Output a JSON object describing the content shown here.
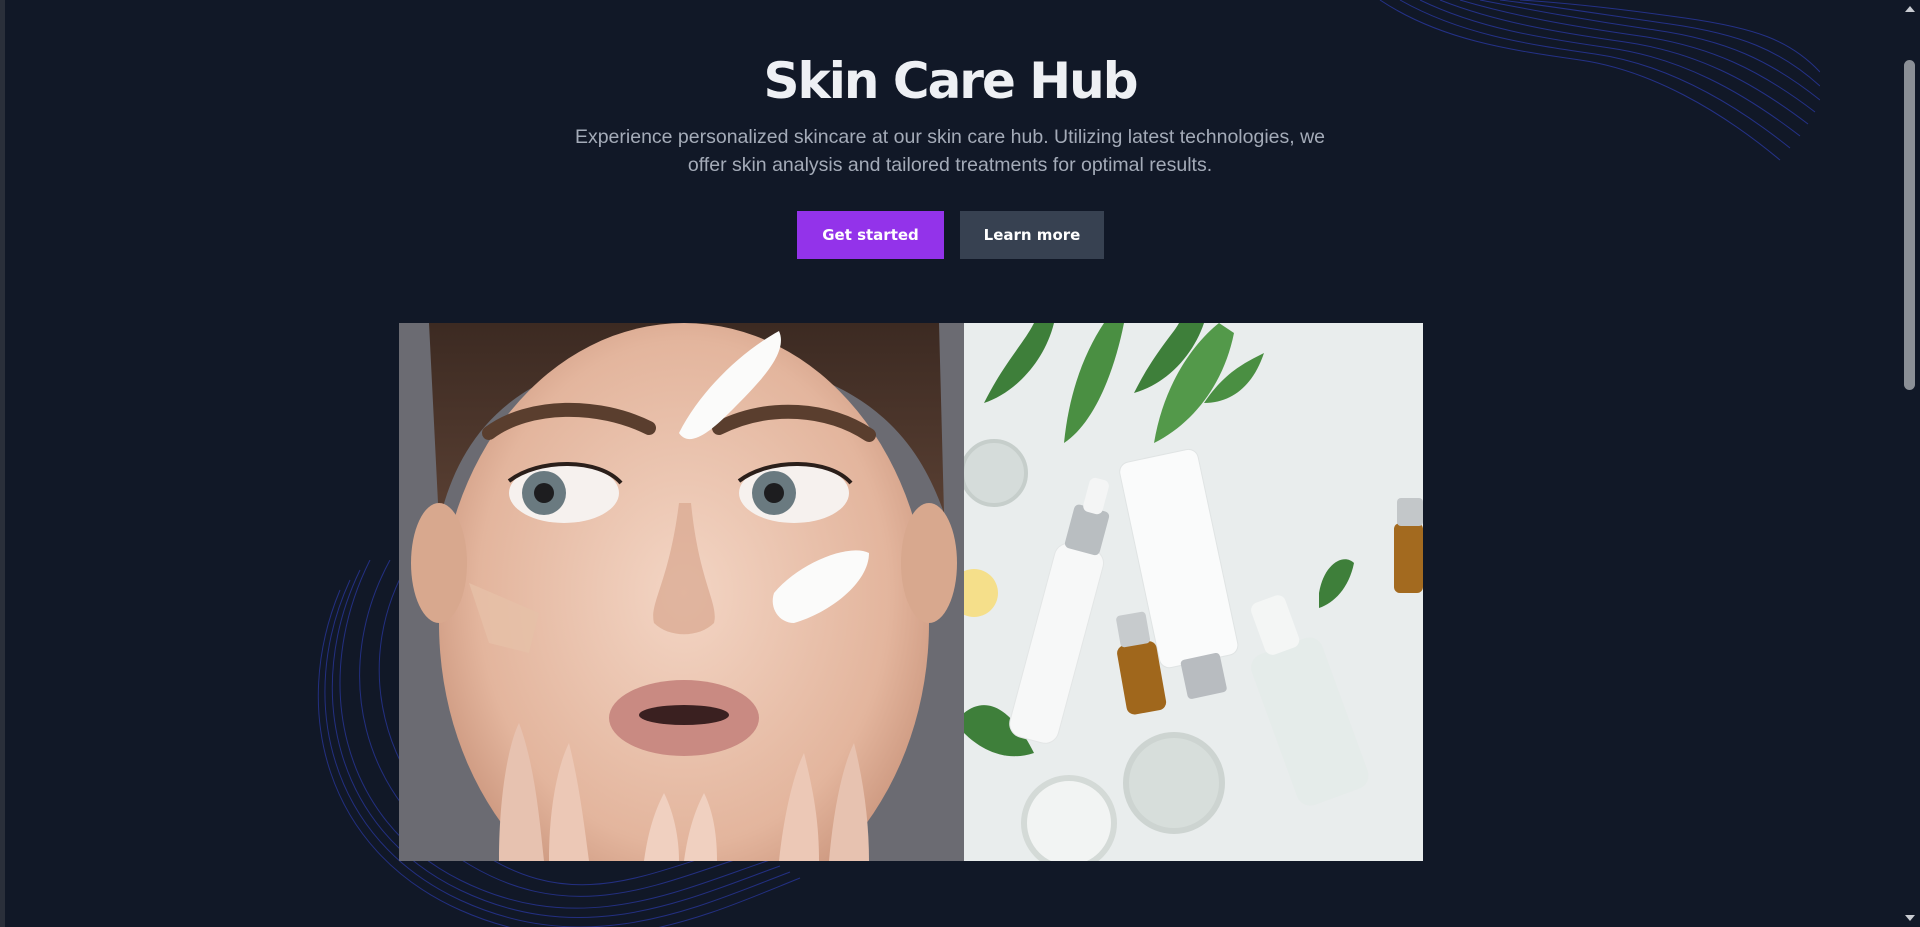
{
  "hero": {
    "title": "Skin Care Hub",
    "subtitle": "Experience personalized skincare at our skin care hub. Utilizing latest technologies, we offer skin analysis and tailored treatments for optimal results.",
    "primary_button": "Get started",
    "secondary_button": "Learn more"
  },
  "colors": {
    "background": "#111827",
    "primary": "#9333ea",
    "secondary": "#374151",
    "title": "#eef0f4",
    "subtitle": "#a4abb8",
    "decor_lines": "#2b3aa8"
  },
  "gallery": {
    "images": [
      {
        "name": "face-cream-photo",
        "description_icon": "portrait-image"
      },
      {
        "name": "skincare-products-photo",
        "description_icon": "product-image"
      }
    ]
  }
}
